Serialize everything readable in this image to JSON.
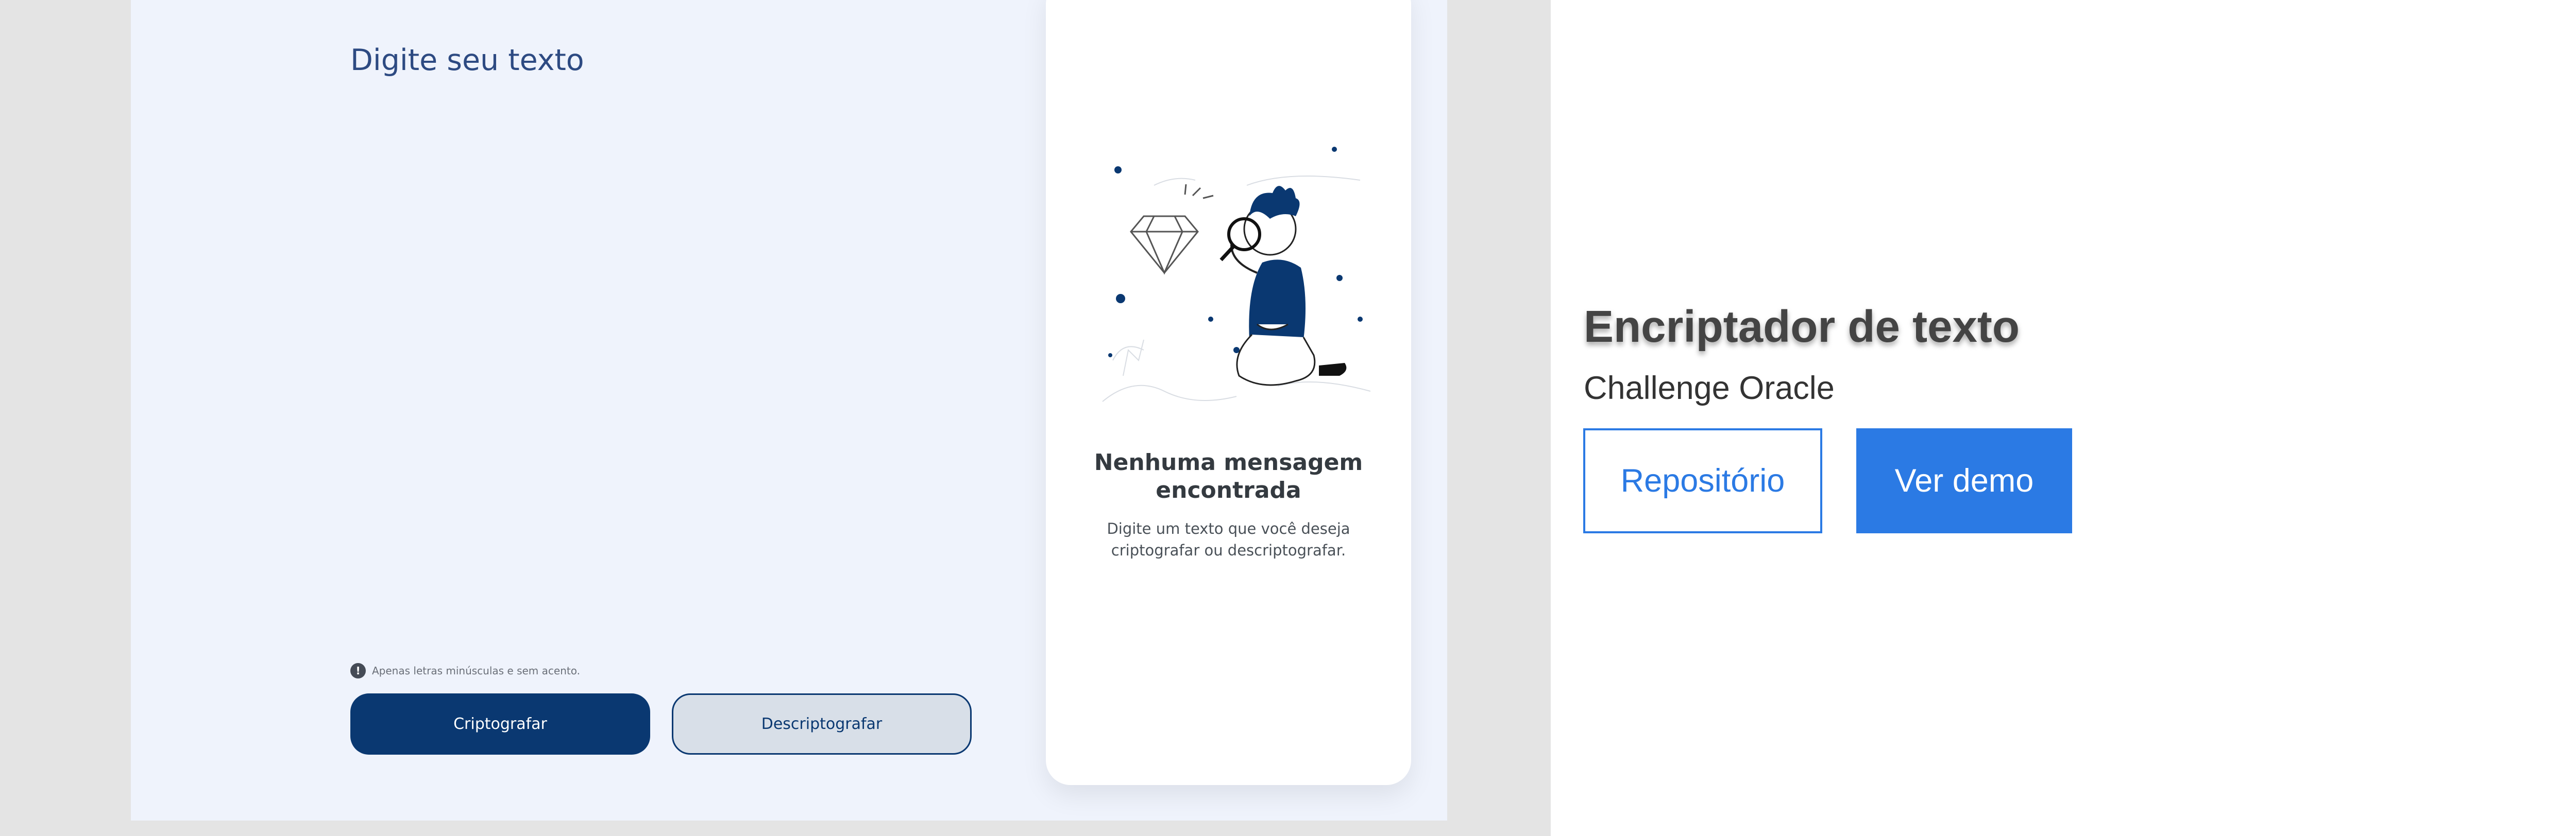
{
  "preview": {
    "input_placeholder": "Digite seu texto",
    "warning_text": "Apenas letras minúsculas e sem acento.",
    "warning_icon": "info-icon",
    "encrypt_label": "Criptografar",
    "decrypt_label": "Descriptografar",
    "empty_title_line1": "Nenhuma mensagem",
    "empty_title_line2": "encontrada",
    "empty_sub_line1": "Digite um texto que você deseja",
    "empty_sub_line2": "criptografar ou descriptografar.",
    "illustration": "boy-with-magnifier-and-diamond-illustration"
  },
  "project": {
    "title": "Encriptador de texto",
    "subtitle": "Challenge Oracle",
    "repo_label": "Repositório",
    "demo_label": "Ver demo"
  },
  "colors": {
    "dark_blue": "#0a3871",
    "light_bg": "#eff3fc",
    "accent_blue": "#2b7ae4",
    "gray_pane": "#e4e4e4"
  }
}
